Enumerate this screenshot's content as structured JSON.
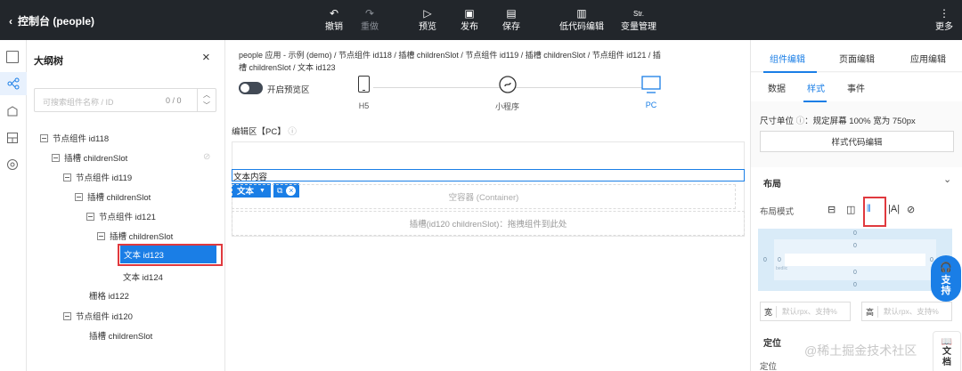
{
  "topbar": {
    "back_label": "控制台 (people)",
    "actions": [
      {
        "label": "撤销",
        "icon": "undo-icon",
        "glyph": "↶"
      },
      {
        "label": "重做",
        "icon": "redo-icon",
        "glyph": "↷"
      },
      {
        "label": "预览",
        "icon": "play-icon",
        "glyph": "▷"
      },
      {
        "label": "发布",
        "icon": "publish-icon",
        "glyph": "▣"
      },
      {
        "label": "保存",
        "icon": "save-icon",
        "glyph": "▤"
      },
      {
        "label": "低代码编辑",
        "icon": "code-file-icon",
        "glyph": "▥"
      },
      {
        "label": "变量管理",
        "icon": "variable-icon",
        "glyph": "Str."
      },
      {
        "label": "更多",
        "icon": "more-icon",
        "glyph": "⋮"
      }
    ]
  },
  "outline": {
    "title": "大纲树",
    "search_placeholder": "可搜索组件名称 / ID",
    "search_count": "0 / 0",
    "nodes": [
      {
        "label": "节点组件 id118",
        "collapsible": true
      },
      {
        "label": "插槽 childrenSlot",
        "collapsible": true
      },
      {
        "label": "节点组件 id119",
        "collapsible": true
      },
      {
        "label": "插槽 childrenSlot",
        "collapsible": true
      },
      {
        "label": "节点组件 id121",
        "collapsible": true
      },
      {
        "label": "插槽 childrenSlot",
        "collapsible": true
      },
      {
        "label": "文本 id123",
        "collapsible": false,
        "selected": true
      },
      {
        "label": "文本 id124",
        "collapsible": false
      },
      {
        "label": "栅格 id122",
        "collapsible": false
      },
      {
        "label": "节点组件 id120",
        "collapsible": true
      },
      {
        "label": "插槽 childrenSlot",
        "collapsible": false
      }
    ]
  },
  "canvas": {
    "breadcrumb_line1": "people 应用 - 示例 (demo)  /  节点组件 id118  /  插槽 childrenSlot  /  节点组件 id119  /  插槽 childrenSlot  /  节点组件 id121  /  插",
    "breadcrumb_line2": "槽 childrenSlot  /  文本 id123",
    "preview_toggle_label": "开启预览区",
    "devices": [
      {
        "label": "H5",
        "icon": "phone-icon"
      },
      {
        "label": "小程序",
        "icon": "mini-program-icon"
      },
      {
        "label": "PC",
        "icon": "monitor-icon",
        "active": true
      }
    ],
    "edit_area_label": "编辑区【PC】",
    "text_content": "文本内容",
    "chip_label": "文本",
    "container_label": "空容器 (Container)",
    "slot_label": "插槽(id120 childrenSlot)：拖拽组件到此处"
  },
  "right": {
    "top_tabs": [
      "组件编辑",
      "页面编辑",
      "应用编辑"
    ],
    "sub_tabs": [
      "数据",
      "样式",
      "事件"
    ],
    "unit_label": "尺寸单位",
    "unit_desc": "：规定屏幕 100% 宽为 750px",
    "style_code_button": "样式代码编辑",
    "layout_section": "布局",
    "layout_mode_label": "布局模式",
    "box_values": [
      "0",
      "0",
      "0",
      "0",
      "0",
      "0",
      "0",
      "0"
    ],
    "box_tag": "bedlic",
    "width_label": "宽",
    "width_placeholder": "默认rpx、支持%",
    "height_label": "高",
    "height_placeholder": "默认rpx、支持%",
    "position_section": "定位",
    "position_label": "定位",
    "support_label": "支持",
    "doc_label": "文档"
  },
  "watermark": "@稀土掘金技术社区",
  "colors": {
    "accent": "#1a7ee6",
    "topbar": "#22262b",
    "highlight": "#e0393e"
  }
}
